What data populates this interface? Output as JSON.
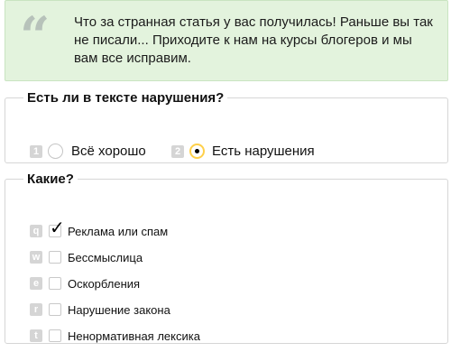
{
  "quote": {
    "icon": "quote-icon",
    "text": "Что за странная статья у вас получилась! Раньше вы так не писали... Приходите к нам на курсы блогеров и мы вам все исправим."
  },
  "violations": {
    "legend": "Есть ли в тексте нарушения?",
    "options": [
      {
        "hotkey": "1",
        "label": "Всё хорошо",
        "checked": false
      },
      {
        "hotkey": "2",
        "label": "Есть нарушения",
        "checked": true
      }
    ]
  },
  "kinds": {
    "legend": "Какие?",
    "options": [
      {
        "hotkey": "q",
        "label": "Реклама или спам",
        "checked": true
      },
      {
        "hotkey": "w",
        "label": "Бессмыслица",
        "checked": false
      },
      {
        "hotkey": "e",
        "label": "Оскорбления",
        "checked": false
      },
      {
        "hotkey": "r",
        "label": "Нарушение закона",
        "checked": false
      },
      {
        "hotkey": "t",
        "label": "Ненормативная лексика",
        "checked": false
      }
    ]
  },
  "colors": {
    "quote_bg": "#e3f3dd",
    "radio_accent": "#ffd04a",
    "hotkey_bg": "#d5d5d5"
  }
}
